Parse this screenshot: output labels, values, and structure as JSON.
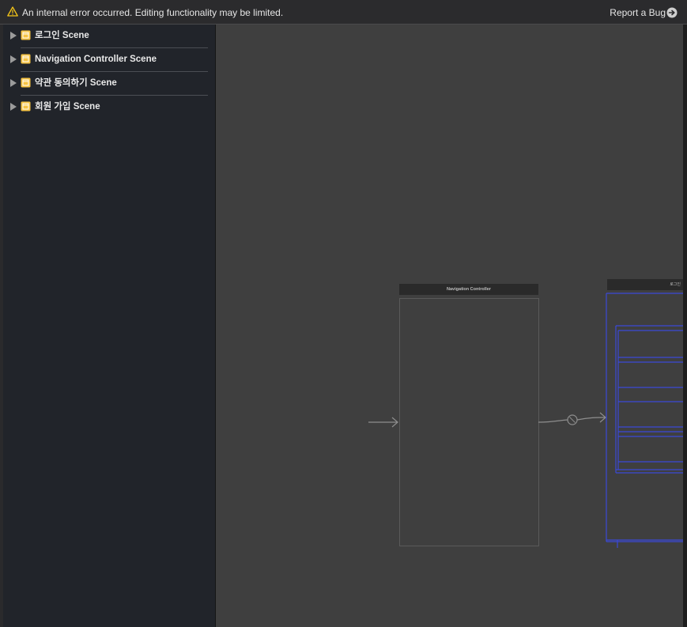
{
  "banner": {
    "error_message": "An internal error occurred. Editing functionality may be limited.",
    "report_bug_label": "Report a Bug",
    "warning_color": "#f5c518"
  },
  "outline": {
    "scenes": [
      {
        "label": "로그인 Scene"
      },
      {
        "label": "Navigation Controller Scene"
      },
      {
        "label": "약관 동의하기 Scene"
      },
      {
        "label": "회원 가입 Scene"
      }
    ],
    "scene_icon_color": "#f6c343"
  },
  "canvas": {
    "navigation_controller_title": "Navigation Controller",
    "login_scene_title": "로그인",
    "constraint_color": "#3a49d8"
  }
}
